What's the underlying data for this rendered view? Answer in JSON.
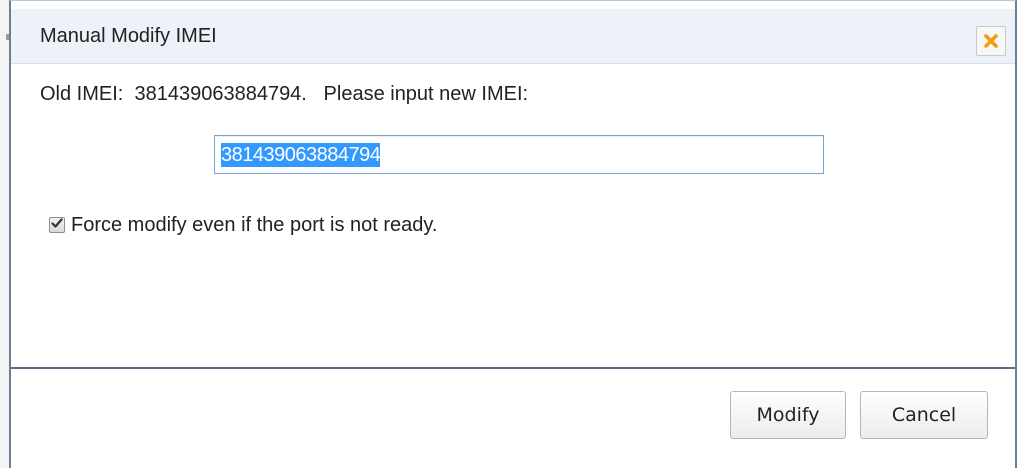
{
  "dialog": {
    "title": "Manual Modify IMEI",
    "close_icon": "close-x-icon",
    "close_icon_color": "#f39c12"
  },
  "body": {
    "info_text": "Old IMEI:  381439063884794.   Please input new IMEI:",
    "imei_input": {
      "value": "381439063884794",
      "selected": true
    },
    "force_checkbox": {
      "checked": true,
      "label": "Force modify even if the port is not ready."
    }
  },
  "footer": {
    "modify_label": "Modify",
    "cancel_label": "Cancel"
  },
  "colors": {
    "title_bar": "#edf1f8",
    "input_border": "#7ba3d2",
    "selection": "#3399ff",
    "divider": "#5d6f87"
  }
}
